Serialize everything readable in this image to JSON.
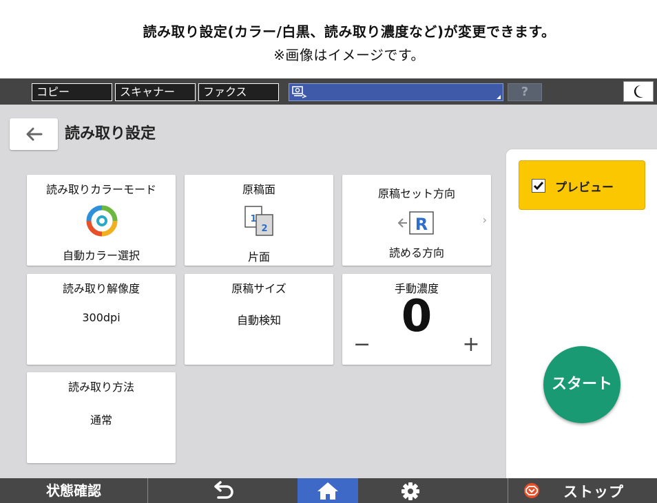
{
  "caption": {
    "line1": "読み取り設定(カラー/白黒、読み取り濃度など)が変更できます。",
    "line2": "※画像はイメージです。"
  },
  "topbar": {
    "tabs": [
      {
        "label": "コピー"
      },
      {
        "label": "スキャナー"
      },
      {
        "label": "ファクス"
      }
    ],
    "help_label": "?",
    "colors": {
      "bar": "#444444",
      "app_bar": "#3f5aa8"
    }
  },
  "page": {
    "title": "読み取り設定"
  },
  "tiles": {
    "color_mode": {
      "label": "読み取りカラーモード",
      "value": "自動カラー選択"
    },
    "original_side": {
      "label": "原稿面",
      "value": "片面",
      "icon_digits": [
        "1",
        "2"
      ]
    },
    "set_direction": {
      "label": "原稿セット方向",
      "value": "読める方向",
      "icon_letter": "R",
      "more": "›"
    },
    "resolution": {
      "label": "読み取り解像度",
      "value": "300dpi"
    },
    "original_size": {
      "label": "原稿サイズ",
      "value": "自動検知"
    },
    "density": {
      "label": "手動濃度",
      "value": "0",
      "minus": "−",
      "plus": "+"
    },
    "scan_method": {
      "label": "読み取り方法",
      "value": "通常"
    }
  },
  "right_panel": {
    "preview_label": "プレビュー",
    "preview_checked": true,
    "start_label": "スタート",
    "colors": {
      "preview": "#fbc700",
      "start": "#1a9a73"
    }
  },
  "bottombar": {
    "status_label": "状態確認",
    "stop_label": "ストップ",
    "colors": {
      "bar": "#474747",
      "home": "#3f69c7",
      "stop_icon": "#e8502a"
    }
  }
}
